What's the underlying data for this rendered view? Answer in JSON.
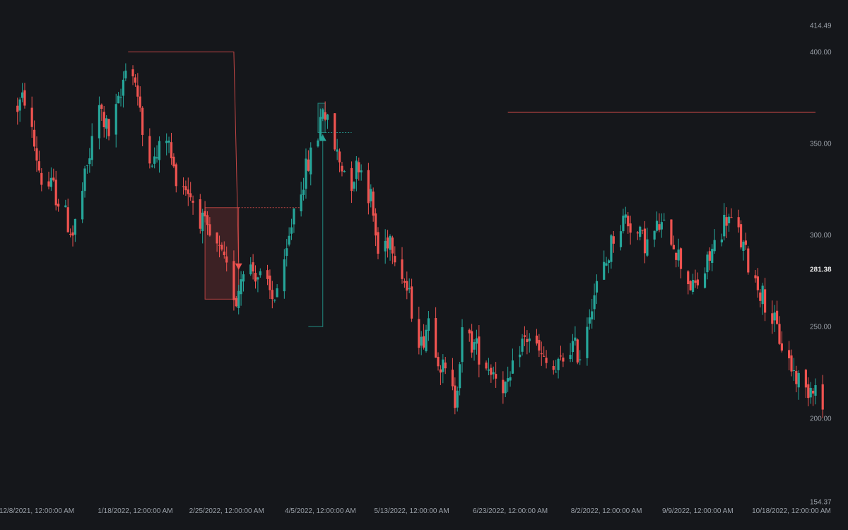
{
  "colors": {
    "background": "#15171b",
    "up": "#26a69a",
    "down": "#ef5350",
    "axis_text": "#9aa0a8",
    "last_price_text": "#e6e6e6"
  },
  "chart_data": {
    "type": "candlestick",
    "title": "",
    "xlabel": "",
    "ylabel": "",
    "ylim": [
      154.37,
      414.49
    ],
    "grid": false,
    "y_ticks": [
      "414.49",
      "400.00",
      "350.00",
      "300.00",
      "250.00",
      "200.00",
      "154.37"
    ],
    "x_ticks": [
      {
        "label": "12/8/2021, 12:00:00 AM",
        "date": "2021-12-08"
      },
      {
        "label": "1/18/2022, 12:00:00 AM",
        "date": "2022-01-18"
      },
      {
        "label": "2/25/2022, 12:00:00 AM",
        "date": "2022-02-25"
      },
      {
        "label": "4/5/2022, 12:00:00 AM",
        "date": "2022-04-05"
      },
      {
        "label": "5/13/2022, 12:00:00 AM",
        "date": "2022-05-13"
      },
      {
        "label": "6/23/2022, 12:00:00 AM",
        "date": "2022-06-23"
      },
      {
        "label": "8/2/2022, 12:00:00 AM",
        "date": "2022-08-02"
      },
      {
        "label": "9/9/2022, 12:00:00 AM",
        "date": "2022-09-09"
      },
      {
        "label": "10/18/2022, 12:00:00 AM",
        "date": "2022-10-18"
      }
    ],
    "last_price": "281.38",
    "date_range": [
      "2021-11-30",
      "2022-10-31"
    ],
    "waypoints": [
      [
        "2021-11-30",
        370
      ],
      [
        "2021-12-03",
        375
      ],
      [
        "2021-12-06",
        355
      ],
      [
        "2021-12-10",
        330
      ],
      [
        "2021-12-15",
        325
      ],
      [
        "2021-12-20",
        310
      ],
      [
        "2021-12-23",
        300
      ],
      [
        "2021-12-28",
        330
      ],
      [
        "2022-01-03",
        370
      ],
      [
        "2022-01-07",
        355
      ],
      [
        "2022-01-12",
        375
      ],
      [
        "2022-01-14",
        395
      ],
      [
        "2022-01-18",
        385
      ],
      [
        "2022-01-21",
        355
      ],
      [
        "2022-01-26",
        340
      ],
      [
        "2022-01-31",
        355
      ],
      [
        "2022-02-03",
        335
      ],
      [
        "2022-02-09",
        325
      ],
      [
        "2022-02-14",
        310
      ],
      [
        "2022-02-17",
        300
      ],
      [
        "2022-02-22",
        290
      ],
      [
        "2022-02-25",
        280
      ],
      [
        "2022-03-01",
        265
      ],
      [
        "2022-03-04",
        285
      ],
      [
        "2022-03-09",
        280
      ],
      [
        "2022-03-14",
        270
      ],
      [
        "2022-03-16",
        265
      ],
      [
        "2022-03-21",
        280
      ],
      [
        "2022-03-25",
        315
      ],
      [
        "2022-03-30",
        335
      ],
      [
        "2022-04-04",
        355
      ],
      [
        "2022-04-06",
        372
      ],
      [
        "2022-04-08",
        360
      ],
      [
        "2022-04-13",
        340
      ],
      [
        "2022-04-18",
        330
      ],
      [
        "2022-04-21",
        340
      ],
      [
        "2022-04-26",
        320
      ],
      [
        "2022-04-29",
        290
      ],
      [
        "2022-05-04",
        300
      ],
      [
        "2022-05-09",
        280
      ],
      [
        "2022-05-12",
        265
      ],
      [
        "2022-05-17",
        240
      ],
      [
        "2022-05-20",
        255
      ],
      [
        "2022-05-25",
        230
      ],
      [
        "2022-05-31",
        210
      ],
      [
        "2022-06-03",
        245
      ],
      [
        "2022-06-08",
        240
      ],
      [
        "2022-06-13",
        230
      ],
      [
        "2022-06-17",
        225
      ],
      [
        "2022-06-22",
        215
      ],
      [
        "2022-06-27",
        240
      ],
      [
        "2022-07-01",
        245
      ],
      [
        "2022-07-07",
        230
      ],
      [
        "2022-07-12",
        225
      ],
      [
        "2022-07-18",
        240
      ],
      [
        "2022-07-22",
        235
      ],
      [
        "2022-07-27",
        265
      ],
      [
        "2022-08-02",
        285
      ],
      [
        "2022-08-05",
        300
      ],
      [
        "2022-08-10",
        310
      ],
      [
        "2022-08-15",
        300
      ],
      [
        "2022-08-19",
        295
      ],
      [
        "2022-08-24",
        305
      ],
      [
        "2022-08-29",
        300
      ],
      [
        "2022-09-02",
        285
      ],
      [
        "2022-09-07",
        270
      ],
      [
        "2022-09-12",
        280
      ],
      [
        "2022-09-16",
        295
      ],
      [
        "2022-09-21",
        310
      ],
      [
        "2022-09-26",
        300
      ],
      [
        "2022-09-30",
        285
      ],
      [
        "2022-10-05",
        270
      ],
      [
        "2022-10-10",
        255
      ],
      [
        "2022-10-14",
        240
      ],
      [
        "2022-10-19",
        225
      ],
      [
        "2022-10-24",
        215
      ],
      [
        "2022-10-27",
        220
      ],
      [
        "2022-10-31",
        205
      ]
    ],
    "annotations": [
      {
        "type": "box",
        "color": "down",
        "start_date": "2022-02-16",
        "end_date": "2022-03-02",
        "y_top": 315,
        "y_bottom": 265
      },
      {
        "type": "dotted_line",
        "color": "down",
        "start_date": "2022-03-02",
        "end_date": "2022-03-28",
        "y": 315
      },
      {
        "type": "polyline",
        "color": "down",
        "points": [
          [
            "2022-01-15",
            400
          ],
          [
            "2022-02-28",
            400
          ],
          [
            "2022-03-02",
            285
          ]
        ]
      },
      {
        "type": "marker",
        "color": "down",
        "direction": "down",
        "date": "2022-03-02",
        "y": 283
      },
      {
        "type": "polyline",
        "color": "up",
        "points": [
          [
            "2022-03-31",
            250
          ],
          [
            "2022-04-06",
            250
          ],
          [
            "2022-04-06",
            355
          ]
        ]
      },
      {
        "type": "marker",
        "color": "up",
        "direction": "up",
        "date": "2022-04-06",
        "y": 353
      },
      {
        "type": "box",
        "color": "up",
        "start_date": "2022-04-04",
        "end_date": "2022-04-07",
        "y_top": 372,
        "y_bottom": 356
      },
      {
        "type": "dotted_line",
        "color": "up",
        "start_date": "2022-04-07",
        "end_date": "2022-04-18",
        "y": 356
      },
      {
        "type": "line",
        "color": "down",
        "start_date": "2022-06-22",
        "end_date": "2022-10-28",
        "y": 367
      }
    ]
  }
}
